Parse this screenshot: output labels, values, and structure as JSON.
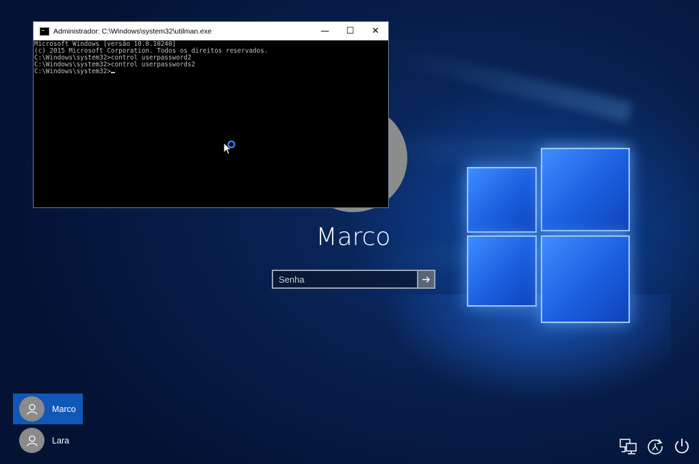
{
  "cmd_window": {
    "title": "Administrador: C:\\Windows\\system32\\utilman.exe",
    "controls": {
      "minimize": "—",
      "maximize": "☐",
      "close": "✕"
    },
    "lines": [
      "Microsoft Windows [versão 10.0.10240]",
      "(c) 2015 Microsoft Corporation. Todos os direitos reservados.",
      "",
      "C:\\Windows\\system32>control userpassword2",
      "",
      "C:\\Windows\\system32>control userpasswords2",
      "",
      "C:\\Windows\\system32>"
    ]
  },
  "login": {
    "username": "Marco",
    "password_placeholder": "Senha",
    "submit_icon": "arrow-right-icon"
  },
  "users": [
    {
      "name": "Marco",
      "selected": true
    },
    {
      "name": "Lara",
      "selected": false
    }
  ],
  "system_icons": [
    "network-icon",
    "ease-of-access-icon",
    "power-icon"
  ],
  "colors": {
    "accent": "#1057b8",
    "desktop_dark": "#071e4a",
    "logo_blue": "#1a5fe0"
  }
}
